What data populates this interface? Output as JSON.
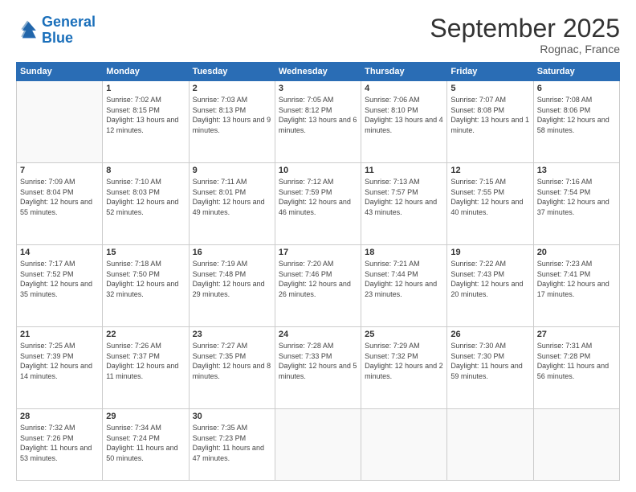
{
  "logo": {
    "line1": "General",
    "line2": "Blue"
  },
  "title": "September 2025",
  "location": "Rognac, France",
  "days_header": [
    "Sunday",
    "Monday",
    "Tuesday",
    "Wednesday",
    "Thursday",
    "Friday",
    "Saturday"
  ],
  "weeks": [
    [
      {
        "day": "",
        "content": ""
      },
      {
        "day": "1",
        "content": "Sunrise: 7:02 AM\nSunset: 8:15 PM\nDaylight: 13 hours\nand 12 minutes."
      },
      {
        "day": "2",
        "content": "Sunrise: 7:03 AM\nSunset: 8:13 PM\nDaylight: 13 hours\nand 9 minutes."
      },
      {
        "day": "3",
        "content": "Sunrise: 7:05 AM\nSunset: 8:12 PM\nDaylight: 13 hours\nand 6 minutes."
      },
      {
        "day": "4",
        "content": "Sunrise: 7:06 AM\nSunset: 8:10 PM\nDaylight: 13 hours\nand 4 minutes."
      },
      {
        "day": "5",
        "content": "Sunrise: 7:07 AM\nSunset: 8:08 PM\nDaylight: 13 hours\nand 1 minute."
      },
      {
        "day": "6",
        "content": "Sunrise: 7:08 AM\nSunset: 8:06 PM\nDaylight: 12 hours\nand 58 minutes."
      }
    ],
    [
      {
        "day": "7",
        "content": "Sunrise: 7:09 AM\nSunset: 8:04 PM\nDaylight: 12 hours\nand 55 minutes."
      },
      {
        "day": "8",
        "content": "Sunrise: 7:10 AM\nSunset: 8:03 PM\nDaylight: 12 hours\nand 52 minutes."
      },
      {
        "day": "9",
        "content": "Sunrise: 7:11 AM\nSunset: 8:01 PM\nDaylight: 12 hours\nand 49 minutes."
      },
      {
        "day": "10",
        "content": "Sunrise: 7:12 AM\nSunset: 7:59 PM\nDaylight: 12 hours\nand 46 minutes."
      },
      {
        "day": "11",
        "content": "Sunrise: 7:13 AM\nSunset: 7:57 PM\nDaylight: 12 hours\nand 43 minutes."
      },
      {
        "day": "12",
        "content": "Sunrise: 7:15 AM\nSunset: 7:55 PM\nDaylight: 12 hours\nand 40 minutes."
      },
      {
        "day": "13",
        "content": "Sunrise: 7:16 AM\nSunset: 7:54 PM\nDaylight: 12 hours\nand 37 minutes."
      }
    ],
    [
      {
        "day": "14",
        "content": "Sunrise: 7:17 AM\nSunset: 7:52 PM\nDaylight: 12 hours\nand 35 minutes."
      },
      {
        "day": "15",
        "content": "Sunrise: 7:18 AM\nSunset: 7:50 PM\nDaylight: 12 hours\nand 32 minutes."
      },
      {
        "day": "16",
        "content": "Sunrise: 7:19 AM\nSunset: 7:48 PM\nDaylight: 12 hours\nand 29 minutes."
      },
      {
        "day": "17",
        "content": "Sunrise: 7:20 AM\nSunset: 7:46 PM\nDaylight: 12 hours\nand 26 minutes."
      },
      {
        "day": "18",
        "content": "Sunrise: 7:21 AM\nSunset: 7:44 PM\nDaylight: 12 hours\nand 23 minutes."
      },
      {
        "day": "19",
        "content": "Sunrise: 7:22 AM\nSunset: 7:43 PM\nDaylight: 12 hours\nand 20 minutes."
      },
      {
        "day": "20",
        "content": "Sunrise: 7:23 AM\nSunset: 7:41 PM\nDaylight: 12 hours\nand 17 minutes."
      }
    ],
    [
      {
        "day": "21",
        "content": "Sunrise: 7:25 AM\nSunset: 7:39 PM\nDaylight: 12 hours\nand 14 minutes."
      },
      {
        "day": "22",
        "content": "Sunrise: 7:26 AM\nSunset: 7:37 PM\nDaylight: 12 hours\nand 11 minutes."
      },
      {
        "day": "23",
        "content": "Sunrise: 7:27 AM\nSunset: 7:35 PM\nDaylight: 12 hours\nand 8 minutes."
      },
      {
        "day": "24",
        "content": "Sunrise: 7:28 AM\nSunset: 7:33 PM\nDaylight: 12 hours\nand 5 minutes."
      },
      {
        "day": "25",
        "content": "Sunrise: 7:29 AM\nSunset: 7:32 PM\nDaylight: 12 hours\nand 2 minutes."
      },
      {
        "day": "26",
        "content": "Sunrise: 7:30 AM\nSunset: 7:30 PM\nDaylight: 11 hours\nand 59 minutes."
      },
      {
        "day": "27",
        "content": "Sunrise: 7:31 AM\nSunset: 7:28 PM\nDaylight: 11 hours\nand 56 minutes."
      }
    ],
    [
      {
        "day": "28",
        "content": "Sunrise: 7:32 AM\nSunset: 7:26 PM\nDaylight: 11 hours\nand 53 minutes."
      },
      {
        "day": "29",
        "content": "Sunrise: 7:34 AM\nSunset: 7:24 PM\nDaylight: 11 hours\nand 50 minutes."
      },
      {
        "day": "30",
        "content": "Sunrise: 7:35 AM\nSunset: 7:23 PM\nDaylight: 11 hours\nand 47 minutes."
      },
      {
        "day": "",
        "content": ""
      },
      {
        "day": "",
        "content": ""
      },
      {
        "day": "",
        "content": ""
      },
      {
        "day": "",
        "content": ""
      }
    ]
  ]
}
